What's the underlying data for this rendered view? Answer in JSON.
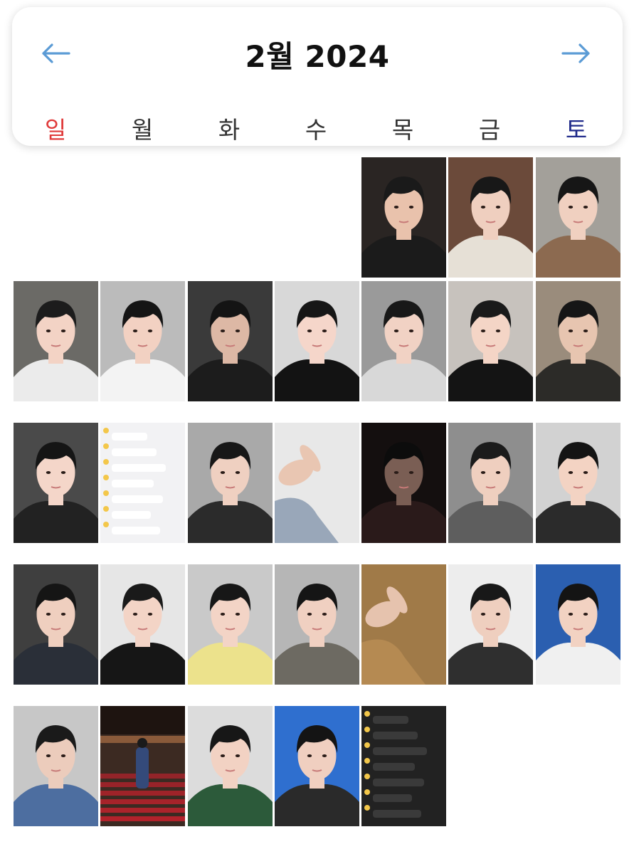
{
  "calendar": {
    "title": "2월 2024",
    "prev_icon": "arrow-left-icon",
    "next_icon": "arrow-right-icon",
    "weekdays": [
      "일",
      "월",
      "화",
      "수",
      "목",
      "금",
      "토"
    ],
    "colors": {
      "sunday": "#e03a3a",
      "saturday": "#1f2a8a",
      "weekday": "#333333",
      "arrow": "#5b9bd5"
    }
  },
  "days": [
    {
      "row": 0,
      "col": 4,
      "kind": "photo",
      "bg": "#2a2523",
      "skin": "#e9c2ac",
      "top": "#1b1b1b",
      "hair": "#1a1a1a"
    },
    {
      "row": 0,
      "col": 5,
      "kind": "photo",
      "bg": "#6b4a3a",
      "skin": "#efcfbf",
      "top": "#e6e0d6",
      "hair": "#181818"
    },
    {
      "row": 0,
      "col": 6,
      "kind": "photo",
      "bg": "#a3a09a",
      "skin": "#f0d0c0",
      "top": "#8c6a50",
      "hair": "#161616"
    },
    {
      "row": 1,
      "col": 0,
      "kind": "photo",
      "bg": "#6b6a66",
      "skin": "#f3d3c5",
      "top": "#ebebeb",
      "hair": "#1c1c1c"
    },
    {
      "row": 1,
      "col": 1,
      "kind": "photo",
      "bg": "#bbbbbb",
      "skin": "#f2d1c2",
      "top": "#f3f3f3",
      "hair": "#151515"
    },
    {
      "row": 1,
      "col": 2,
      "kind": "photo",
      "bg": "#3a3a3a",
      "skin": "#ddb8a5",
      "top": "#1c1c1c",
      "hair": "#141414"
    },
    {
      "row": 1,
      "col": 3,
      "kind": "photo",
      "bg": "#d8d8d8",
      "skin": "#f5d6ca",
      "top": "#131313",
      "hair": "#161616"
    },
    {
      "row": 1,
      "col": 4,
      "kind": "photo",
      "bg": "#9a9a9a",
      "skin": "#f1d2c4",
      "top": "#d8d8d8",
      "hair": "#181818"
    },
    {
      "row": 1,
      "col": 5,
      "kind": "photo",
      "bg": "#c7c2bd",
      "skin": "#f4d5c6",
      "top": "#141414",
      "hair": "#1a1a1a"
    },
    {
      "row": 1,
      "col": 6,
      "kind": "photo",
      "bg": "#9a8c7c",
      "skin": "#e7c5b0",
      "top": "#2c2b28",
      "hair": "#161616"
    },
    {
      "row": 2,
      "col": 0,
      "kind": "photo",
      "bg": "#4a4a4a",
      "skin": "#f4d6c9",
      "top": "#222222",
      "hair": "#151515"
    },
    {
      "row": 2,
      "col": 1,
      "kind": "chat",
      "theme": "light"
    },
    {
      "row": 2,
      "col": 2,
      "kind": "photo",
      "bg": "#a9a9a9",
      "skin": "#efd0c1",
      "top": "#2b2b2b",
      "hair": "#171717"
    },
    {
      "row": 2,
      "col": 3,
      "kind": "hand",
      "bg": "#e8e8e8",
      "skin": "#e9c6b2",
      "cloth": "#8b9bb0"
    },
    {
      "row": 2,
      "col": 4,
      "kind": "photo",
      "bg": "#140f0f",
      "skin": "#7a5e54",
      "top": "#2a1a1a",
      "hair": "#0c0c0c"
    },
    {
      "row": 2,
      "col": 5,
      "kind": "photo",
      "bg": "#8e8e8e",
      "skin": "#efcfbf",
      "top": "#5e5e5e",
      "hair": "#1b1b1b"
    },
    {
      "row": 2,
      "col": 6,
      "kind": "photo",
      "bg": "#d2d2d2",
      "skin": "#f3d3c3",
      "top": "#2b2b2b",
      "hair": "#141414"
    },
    {
      "row": 3,
      "col": 0,
      "kind": "photo",
      "bg": "#3f3f3f",
      "skin": "#efcfbf",
      "top": "#2a2f38",
      "hair": "#151515"
    },
    {
      "row": 3,
      "col": 1,
      "kind": "photo",
      "bg": "#e6e6e6",
      "skin": "#f3d4c6",
      "top": "#161616",
      "hair": "#1a1a1a"
    },
    {
      "row": 3,
      "col": 2,
      "kind": "photo",
      "bg": "#c9c9c9",
      "skin": "#f3d4c6",
      "top": "#ece28c",
      "hair": "#171717"
    },
    {
      "row": 3,
      "col": 3,
      "kind": "photo",
      "bg": "#b6b6b6",
      "skin": "#f0d0c1",
      "top": "#6d6a62",
      "hair": "#151515"
    },
    {
      "row": 3,
      "col": 4,
      "kind": "hand",
      "bg": "#a07a48",
      "skin": "#e6c3ae",
      "cloth": "#b88d55"
    },
    {
      "row": 3,
      "col": 5,
      "kind": "photo",
      "bg": "#ededed",
      "skin": "#efcfbf",
      "top": "#2f2f2f",
      "hair": "#181818"
    },
    {
      "row": 3,
      "col": 6,
      "kind": "photo",
      "bg": "#2b5fb0",
      "skin": "#f2d2c2",
      "top": "#f0f0f0",
      "hair": "#141414"
    },
    {
      "row": 4,
      "col": 0,
      "kind": "photo",
      "bg": "#c7c7c7",
      "skin": "#ecccbc",
      "top": "#4d6ea0",
      "hair": "#1a1a1a"
    },
    {
      "row": 4,
      "col": 1,
      "kind": "theater",
      "bg": "#3c2a22",
      "seats": "#b8222c",
      "coat": "#344a7a"
    },
    {
      "row": 4,
      "col": 2,
      "kind": "photo",
      "bg": "#dcdcdc",
      "skin": "#f2d2c3",
      "top": "#2c5a3a",
      "hair": "#171717"
    },
    {
      "row": 4,
      "col": 3,
      "kind": "photo",
      "bg": "#2f6fcf",
      "skin": "#f0cfc0",
      "top": "#2a2a2a",
      "hair": "#141414"
    },
    {
      "row": 4,
      "col": 4,
      "kind": "chat",
      "theme": "dark"
    }
  ]
}
